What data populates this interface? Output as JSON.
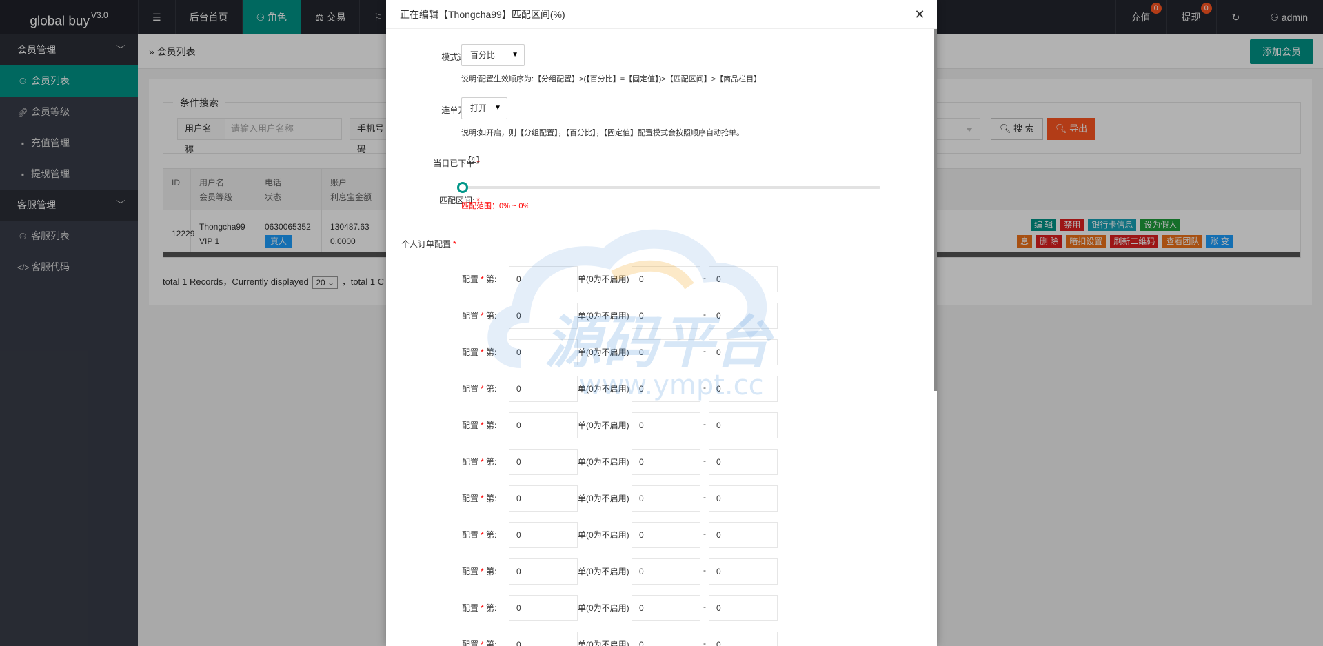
{
  "app": {
    "name": "global buy",
    "version": "V3.0"
  },
  "topnav": {
    "menu_icon": "menu-icon",
    "items": [
      {
        "label": "后台首页",
        "icon": ""
      },
      {
        "label": "角色",
        "icon": "user-icon"
      },
      {
        "label": "交易",
        "icon": "scale-icon"
      },
      {
        "label": "",
        "icon": "flag-icon"
      }
    ],
    "right": [
      {
        "label": "充值",
        "badge": "0"
      },
      {
        "label": "提现",
        "badge": "0"
      },
      {
        "label": "",
        "icon": "refresh-icon"
      },
      {
        "label": "admin",
        "icon": "user-icon"
      }
    ]
  },
  "sidebar": {
    "groups": [
      {
        "label": "会员管理",
        "items": [
          {
            "label": "会员列表",
            "icon": "user-icon",
            "active": true
          },
          {
            "label": "会员等级",
            "icon": "link-icon"
          },
          {
            "label": "充值管理",
            "icon": "chat-icon"
          },
          {
            "label": "提现管理",
            "icon": "chat-icon"
          }
        ]
      },
      {
        "label": "客服管理",
        "items": [
          {
            "label": "客服列表",
            "icon": "users-icon"
          },
          {
            "label": "客服代码",
            "icon": "code-icon"
          }
        ]
      }
    ]
  },
  "main": {
    "breadcrumb": "会员列表",
    "add_button": "添加会员",
    "search": {
      "legend": "条件搜索",
      "username_label": "用户名称",
      "username_placeholder": "请输入用户名称",
      "phone_label": "手机号码",
      "search_button": "搜 索",
      "export_button": "导出"
    },
    "table": {
      "headers": [
        {
          "line1": "ID",
          "line2": ""
        },
        {
          "line1": "用户名",
          "line2": "会员等级"
        },
        {
          "line1": "电话",
          "line2": "状态"
        },
        {
          "line1": "账户",
          "line2": "利息宝金额"
        }
      ],
      "row": {
        "id": "12229",
        "username": "Thongcha99",
        "level": "VIP 1",
        "phone": "0630065352",
        "status": "真人",
        "balance": "130487.63",
        "interest": "0.0000"
      },
      "actions_row1": [
        "编 辑",
        "禁用",
        "银行卡信息",
        "设为假人"
      ],
      "actions_row2": [
        "息",
        "删 除",
        "暗扣设置",
        "刷新二维码",
        "查看团队",
        "账 变"
      ]
    },
    "pager": {
      "prefix": "total 1 Records，Currently displayed",
      "per_page": "20",
      "suffix": "，total 1 C"
    }
  },
  "modal": {
    "title": "正在编辑【Thongcha99】匹配区间(%)",
    "mode": {
      "label": "模式选项",
      "value": "百分比",
      "note": "说明:配置生效顺序为:【分组配置】>(【百分比】=【固定值】)>【匹配区间】>【商品栏目】"
    },
    "chain": {
      "label": "连单开关",
      "value": "打开",
      "note": "说明:如开启，则【分组配置】，【百分比】，【固定值】配置模式会按照顺序自动抢单。"
    },
    "today": {
      "label": "当日已下单",
      "value": "【1】"
    },
    "range": {
      "label": "匹配区间:",
      "text": "匹配范围：0% ~ 0%",
      "min": 0,
      "max": 0
    },
    "personal": {
      "label": "个人订单配置"
    },
    "config_rows": {
      "label": "配置",
      "unit_before": "第:",
      "unit_mid": "单(0为不启用)",
      "dash": "-",
      "rows": [
        {
          "order": "0",
          "min": "0",
          "max": "0"
        },
        {
          "order": "0",
          "min": "0",
          "max": "0"
        },
        {
          "order": "0",
          "min": "0",
          "max": "0"
        },
        {
          "order": "0",
          "min": "0",
          "max": "0"
        },
        {
          "order": "0",
          "min": "0",
          "max": "0"
        },
        {
          "order": "0",
          "min": "0",
          "max": "0"
        },
        {
          "order": "0",
          "min": "0",
          "max": "0"
        },
        {
          "order": "0",
          "min": "0",
          "max": "0"
        },
        {
          "order": "0",
          "min": "0",
          "max": "0"
        },
        {
          "order": "0",
          "min": "0",
          "max": "0"
        },
        {
          "order": "0",
          "min": "0",
          "max": "0"
        }
      ]
    },
    "watermark": {
      "text": "源码平台",
      "url": "www.ympt.cc"
    }
  },
  "colors": {
    "accent": "#009688",
    "danger": "#ff5722",
    "sidebar_bg": "#393d49",
    "topbar_bg": "#23262e"
  }
}
